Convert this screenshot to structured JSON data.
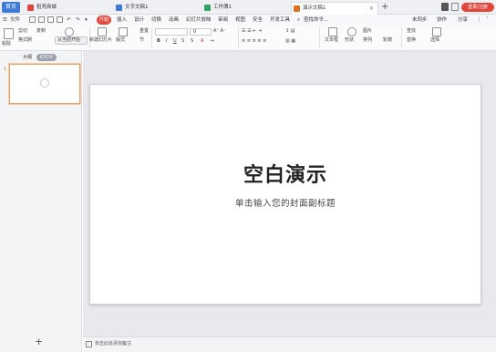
{
  "titlebar": {
    "home_tab": "首页",
    "tabs": [
      {
        "label": "稻壳商城",
        "icon_color": "#e0463c"
      },
      {
        "label": "文字文稿1",
        "icon_color": "#3d7bd6"
      },
      {
        "label": "工作簿1",
        "icon_color": "#2fa36b"
      },
      {
        "label": "演示文稿1",
        "icon_color": "#e07020",
        "active": true
      }
    ],
    "add_tab": "+",
    "login_button": "登录/注册",
    "window_controls": [
      "minimize-icon",
      "maximize-icon",
      "close-icon"
    ]
  },
  "menubar": {
    "file": "文件",
    "start": "开始",
    "items": [
      "插入",
      "设计",
      "切换",
      "动画",
      "幻灯片放映",
      "审阅",
      "视图",
      "安全",
      "开发工具"
    ],
    "search": "查找命令...",
    "right": [
      "未同步",
      "协作",
      "分享"
    ]
  },
  "ribbon": {
    "paste": "粘贴",
    "cut": "剪切",
    "copy": "复制",
    "format_painter": "格式刷",
    "play_from_current": "从当前开始",
    "new_slide": "新建幻灯片",
    "layout": "版式",
    "section": "节",
    "reset": "重置",
    "font_size": "0",
    "textbox": "文本框",
    "shape": "形状",
    "picture": "图片",
    "arrange": "排列",
    "outline": "轮廓",
    "find": "查找",
    "replace": "替换",
    "select": "选择"
  },
  "left_panel": {
    "tab_outline": "大纲",
    "tab_slides": "幻灯片",
    "slide_number": "1",
    "add_slide": "+"
  },
  "slide": {
    "title": "空白演示",
    "subtitle": "单击输入您的封面副标题"
  },
  "notes": {
    "placeholder": "单击此处添加备注"
  }
}
